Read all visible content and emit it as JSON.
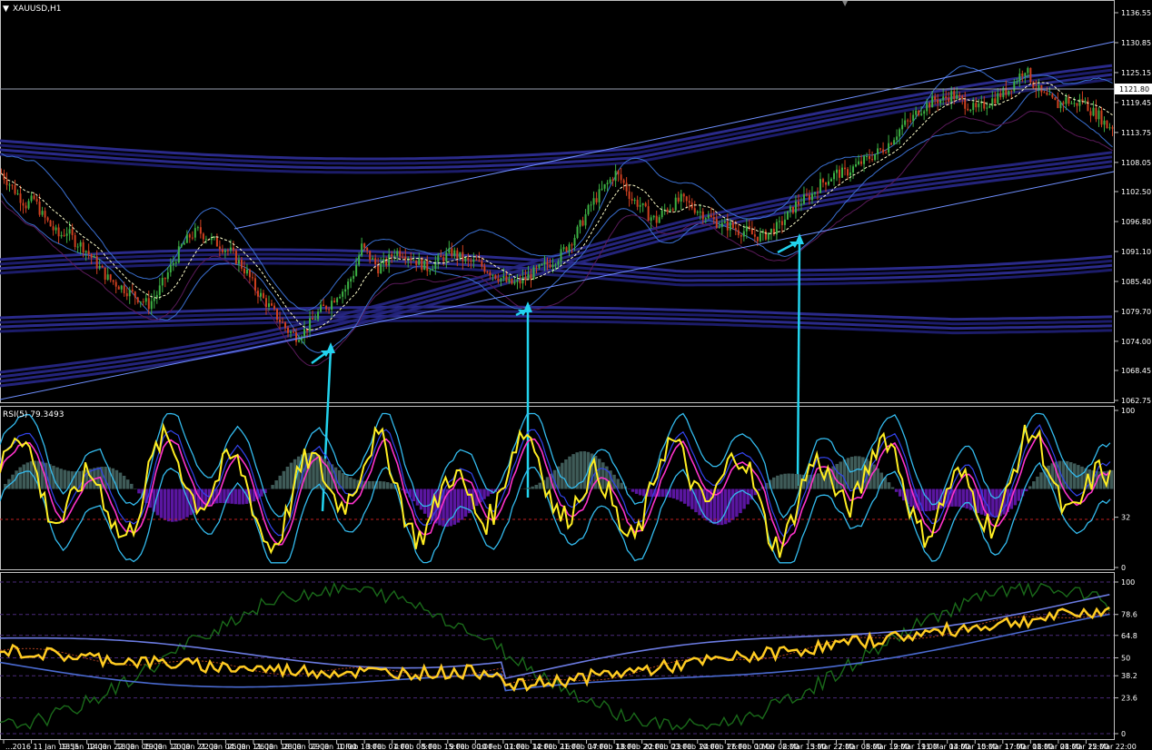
{
  "symbol_label": "XAUUSD,H1",
  "rsi_label": "RSI(5) 79.3493",
  "current_price_label": "1121.80",
  "colors": {
    "background": "#000000",
    "axis": "#c0c0c0",
    "bull": "#3cb043",
    "bear": "#d04020",
    "price_line": "#ffffff",
    "envelope": "#2a2a8a",
    "bollinger": "#3a6fd0",
    "channel": "#6f8fff",
    "arrow": "#22d3ee",
    "rsi": "#ffee22",
    "rsi_band": "#33bbee",
    "rsi_ma": "#ff33cc",
    "hist_up": "#3f5b58",
    "hist_down": "#5a16a0",
    "stoch_main": "#ffcc22",
    "stoch_green": "#1a6a1a"
  },
  "price_axis": {
    "ticks": [
      "1136.55",
      "1130.85",
      "1125.15",
      "1119.45",
      "1113.75",
      "1108.05",
      "1102.50",
      "1096.80",
      "1091.10",
      "1085.40",
      "1079.70",
      "1074.00",
      "1068.45",
      "1062.75"
    ],
    "min": 1062.75,
    "max": 1136.55
  },
  "rsi_axis": {
    "ticks": [
      "100",
      "32",
      "0"
    ]
  },
  "lower_axis": {
    "ticks": [
      "100",
      "78.6",
      "64.8",
      "50",
      "38.2",
      "23.6",
      "0"
    ]
  },
  "time_axis": {
    "labels": [
      "...2016",
      "11 Jan 19:55",
      "13 Jan 12:00",
      "14 Jan 22:00",
      "18 Jan 05:00",
      "19 Jan 12:00",
      "20 Jan 21:00",
      "22 Jan 04:00",
      "25 Jan 11:00",
      "26 Jan 18:00",
      "28 Jan 02:00",
      "29 Jan 10:00",
      "1 Feb 18:00",
      "3 Feb 01:00",
      "4 Feb 08:00",
      "5 Feb 15:00",
      "9 Feb 00:00",
      "10 Feb 07:00",
      "11 Feb 14:00",
      "12 Feb 21:00",
      "16 Feb 04:00",
      "17 Feb 13:00",
      "18 Feb 20:00",
      "22 Feb 03:00",
      "23 Feb 10:00",
      "24 Feb 17:00",
      "26 Feb 00:00",
      "1 Mar 08:00",
      "2 Mar 15:00",
      "3 Mar 22:00",
      "7 Mar 05:00",
      "8 Mar 12:00",
      "9 Mar 19:00",
      "11 Mar 03:00",
      "14 Mar 10:00",
      "15 Mar 17:00",
      "17 Mar 01:00",
      "18 Mar 08:00",
      "21 Mar 15:00",
      "22 Mar 22:00"
    ]
  },
  "chart_data": {
    "type": "candlestick",
    "symbol": "XAUUSD",
    "timeframe": "H1",
    "last_price": 1121.8,
    "price_series": [
      1106,
      1104,
      1102,
      1100,
      1101,
      1098,
      1096,
      1094,
      1095,
      1093,
      1092,
      1090,
      1088,
      1086,
      1085,
      1084,
      1083,
      1082,
      1081,
      1083,
      1086,
      1089,
      1092,
      1094,
      1095,
      1094,
      1093,
      1092,
      1091,
      1089,
      1087,
      1084,
      1082,
      1080,
      1078,
      1076,
      1075,
      1076,
      1078,
      1080,
      1081,
      1083,
      1084,
      1087,
      1092,
      1090,
      1088,
      1089,
      1091,
      1091,
      1090,
      1089,
      1088,
      1089,
      1090,
      1091,
      1090,
      1089,
      1089,
      1088,
      1087,
      1086,
      1085,
      1085,
      1086,
      1087,
      1088,
      1089,
      1090,
      1092,
      1094,
      1097,
      1100,
      1102,
      1104,
      1106,
      1104,
      1101,
      1100,
      1098,
      1097,
      1099,
      1100,
      1101,
      1100,
      1099,
      1098,
      1097,
      1096,
      1096,
      1095,
      1095,
      1094,
      1094,
      1095,
      1096,
      1098,
      1100,
      1101,
      1102,
      1104,
      1105,
      1106,
      1106,
      1107,
      1108,
      1109,
      1110,
      1111,
      1113,
      1115,
      1116,
      1118,
      1119,
      1120,
      1120,
      1121,
      1120,
      1119,
      1118,
      1119,
      1120,
      1121,
      1122,
      1124,
      1126,
      1123,
      1121,
      1120,
      1119,
      1120,
      1119,
      1120,
      1118,
      1117,
      1115
    ],
    "rsi": {
      "period": 5,
      "last_value": 79.3493,
      "levels": [
        32
      ],
      "range": [
        0,
        100
      ]
    },
    "annotations": {
      "arrows": 3,
      "channel_lines": 2
    }
  }
}
